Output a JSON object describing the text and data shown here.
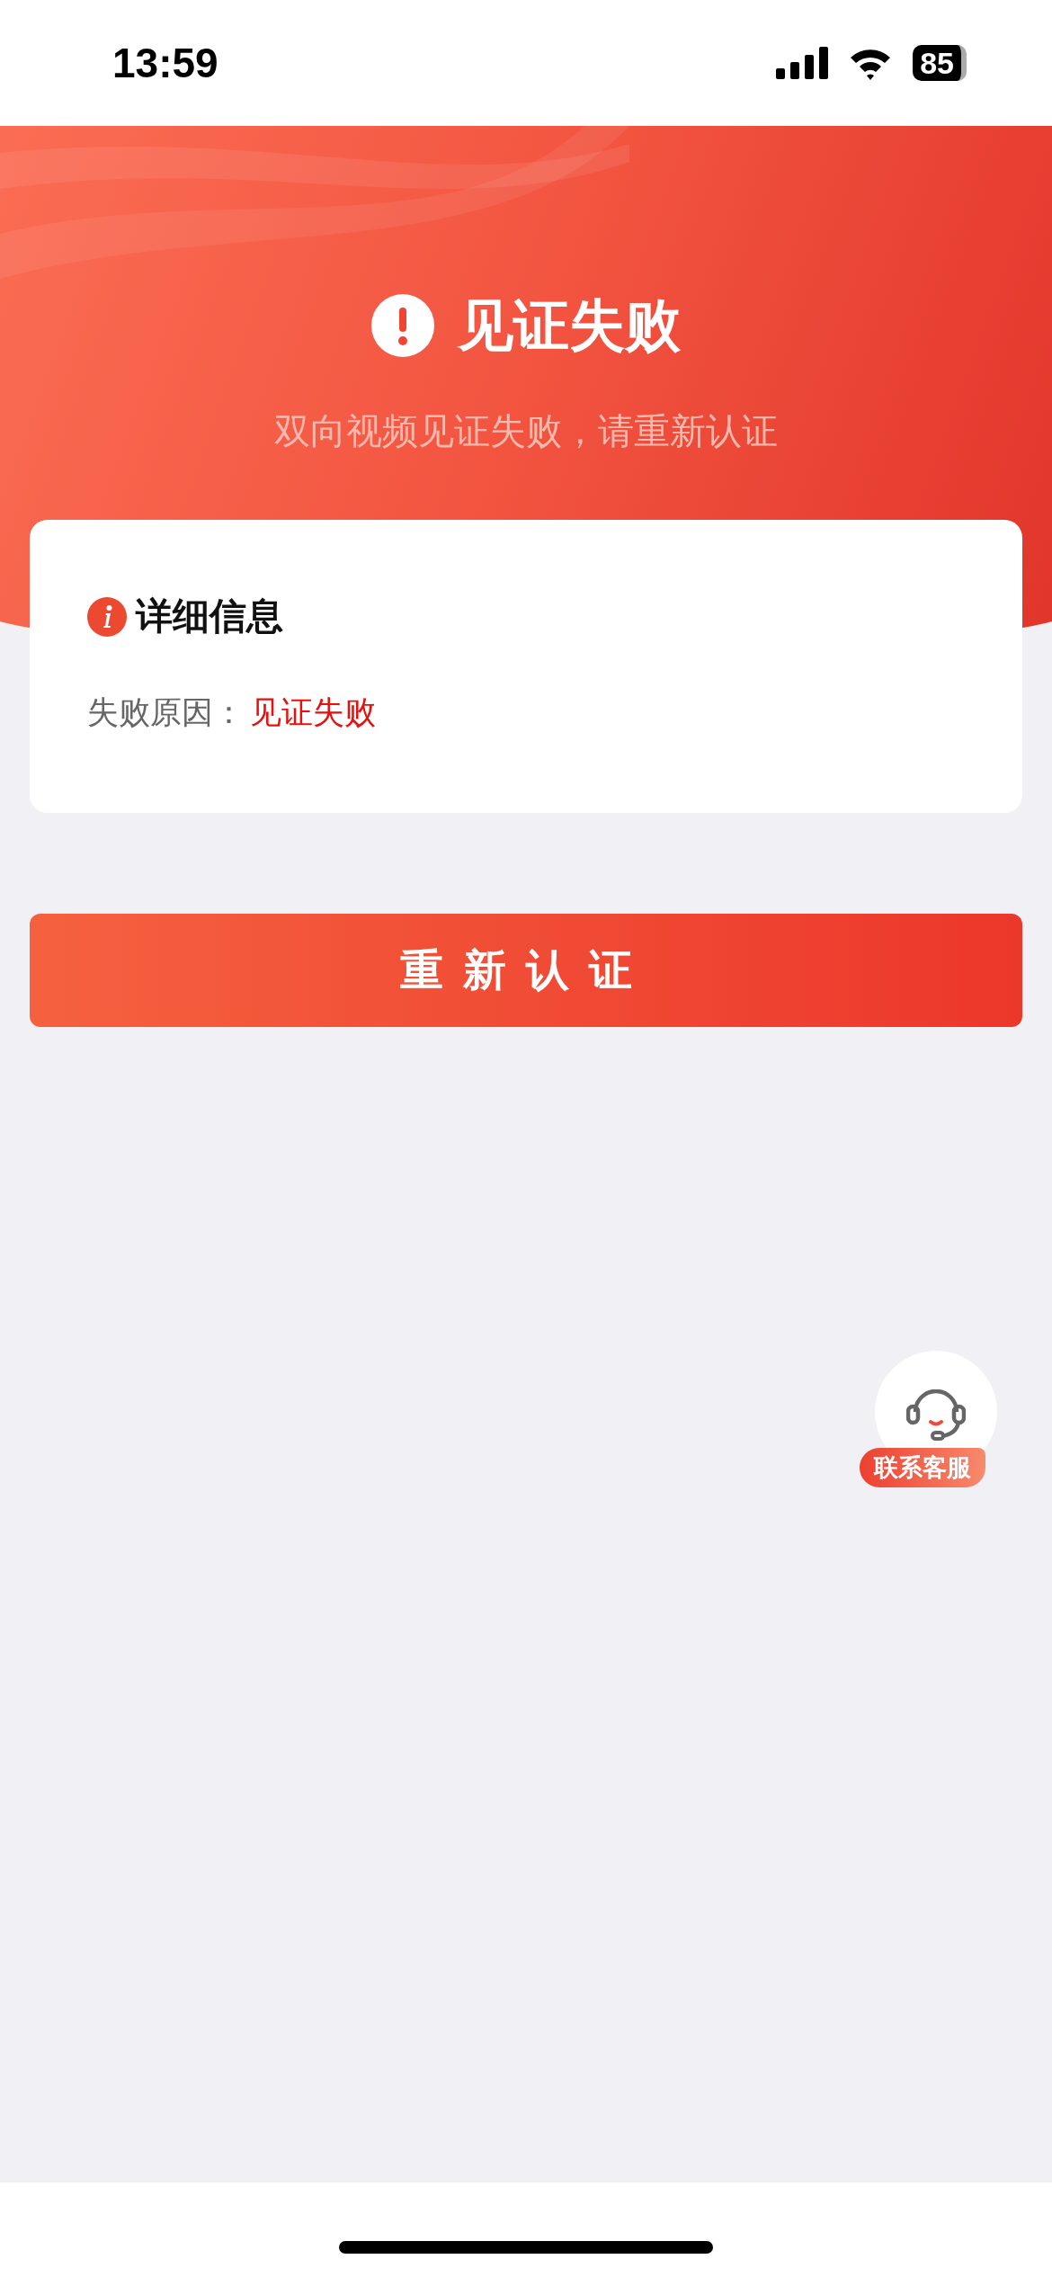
{
  "status_bar": {
    "time": "13:59",
    "battery": "85"
  },
  "header": {
    "title": "见证失败",
    "subtitle": "双向视频见证失败，请重新认证"
  },
  "details": {
    "heading": "详细信息",
    "rows": [
      {
        "label": "失败原因：",
        "value": "见证失败"
      }
    ]
  },
  "primary_button": "重新认证",
  "service_button": {
    "label": "联系客服"
  }
}
